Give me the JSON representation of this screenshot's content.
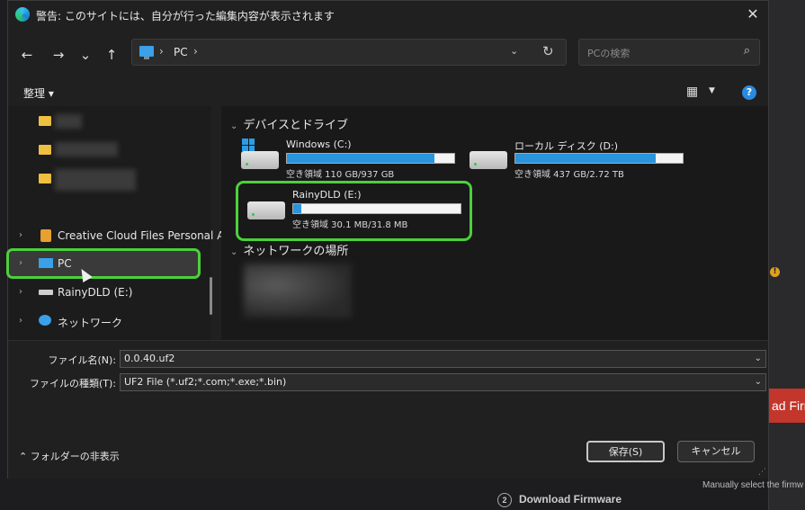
{
  "background": {
    "button_label": "ad Firm",
    "note": "Manually select the firmw",
    "step_num": "2",
    "step_label": "Download Firmware",
    "warn": "!"
  },
  "dialog": {
    "title": "警告: このサイトには、自分が行った編集内容が表示されます",
    "close": "✕",
    "nav": {
      "back": "←",
      "forward": "→",
      "recent": "⌄",
      "up": "↑"
    },
    "address": {
      "sep": "›",
      "location": "PC",
      "dropdown": "⌄",
      "refresh": "↻"
    },
    "search": {
      "placeholder": "PCの検索",
      "icon": "⌕"
    },
    "toolbar": {
      "organize": "整理 ▾",
      "view_icon": "▦",
      "view_dropdown": "▼",
      "help": "?"
    },
    "sidebar": {
      "items": [
        {
          "label": "Creative Cloud Files Personal A"
        },
        {
          "label": "PC"
        },
        {
          "label": "RainyDLD (E:)"
        },
        {
          "label": "ネットワーク"
        }
      ]
    },
    "content": {
      "devices_header": "デバイスとドライブ",
      "network_header": "ネットワークの場所",
      "drives": [
        {
          "name": "Windows (C:)",
          "free": "空き領域 110 GB/937 GB",
          "used_fraction": 0.88
        },
        {
          "name": "ローカル ディスク (D:)",
          "free": "空き領域 437 GB/2.72 TB",
          "used_fraction": 0.84
        },
        {
          "name": "RainyDLD (E:)",
          "free": "空き領域 30.1 MB/31.8 MB",
          "used_fraction": 0.05
        }
      ]
    },
    "filename": {
      "label": "ファイル名(N):",
      "value": "0.0.40.uf2"
    },
    "filetype": {
      "label": "ファイルの種類(T):",
      "value": "UF2 File (*.uf2;*.com;*.exe;*.bin)"
    },
    "hide_folders": "フォルダーの非表示",
    "save_button": "保存(S)",
    "cancel_button": "キャンセル",
    "colors": {
      "accent": "#2a94dc",
      "highlight": "#4cd03c"
    }
  }
}
